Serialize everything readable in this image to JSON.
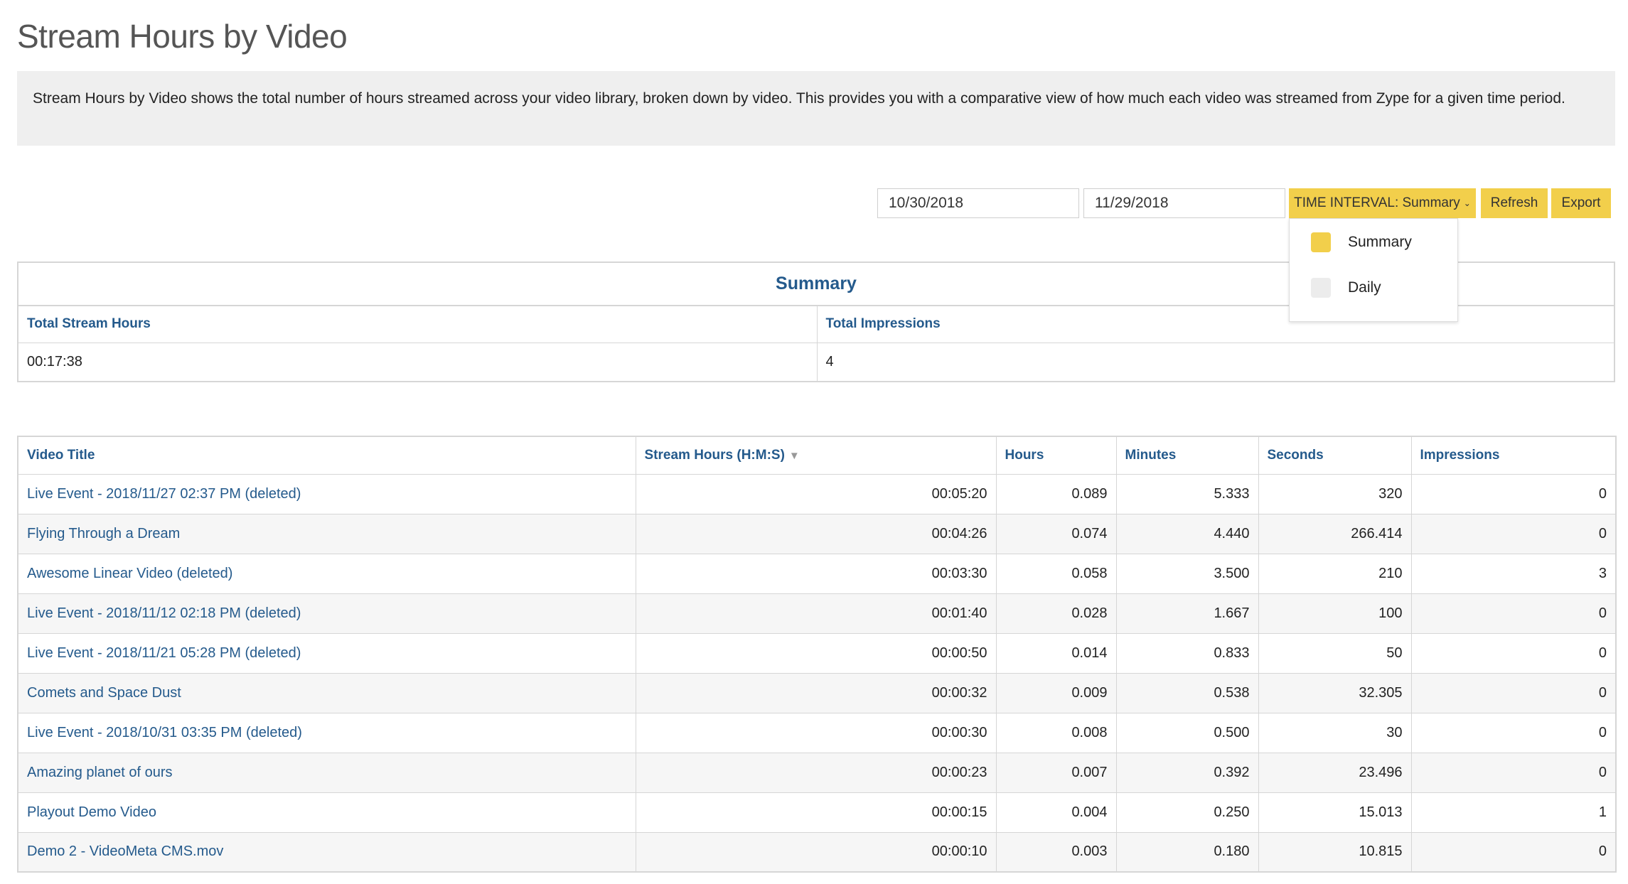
{
  "page": {
    "title": "Stream Hours by Video",
    "description": "Stream Hours by Video shows the total number of hours streamed across your video library, broken down by video. This provides you with a comparative view of how much each video was streamed from Zype for a given time period."
  },
  "controls": {
    "start_date": "10/30/2018",
    "end_date": "11/29/2018",
    "interval_label": "TIME INTERVAL: Summary",
    "refresh_label": "Refresh",
    "export_label": "Export"
  },
  "interval_menu": {
    "items": [
      {
        "label": "Summary",
        "swatch_color": "#f2cf4b"
      },
      {
        "label": "Daily",
        "swatch_color": "#ececec"
      }
    ]
  },
  "summary": {
    "heading": "Summary",
    "total_stream_hours_label": "Total Stream Hours",
    "total_impressions_label": "Total Impressions",
    "total_stream_hours": "00:17:38",
    "total_impressions": "4"
  },
  "videos": {
    "columns": [
      "Video Title",
      "Stream Hours (H:M:S)",
      "Hours",
      "Minutes",
      "Seconds",
      "Impressions"
    ],
    "rows": [
      {
        "title": "Live Event - 2018/11/27 02:37 PM (deleted)",
        "hms": "00:05:20",
        "hours": "0.089",
        "minutes": "5.333",
        "seconds": "320",
        "impressions": "0"
      },
      {
        "title": "Flying Through a Dream",
        "hms": "00:04:26",
        "hours": "0.074",
        "minutes": "4.440",
        "seconds": "266.414",
        "impressions": "0"
      },
      {
        "title": "Awesome Linear Video (deleted)",
        "hms": "00:03:30",
        "hours": "0.058",
        "minutes": "3.500",
        "seconds": "210",
        "impressions": "3"
      },
      {
        "title": "Live Event - 2018/11/12 02:18 PM (deleted)",
        "hms": "00:01:40",
        "hours": "0.028",
        "minutes": "1.667",
        "seconds": "100",
        "impressions": "0"
      },
      {
        "title": "Live Event - 2018/11/21 05:28 PM (deleted)",
        "hms": "00:00:50",
        "hours": "0.014",
        "minutes": "0.833",
        "seconds": "50",
        "impressions": "0"
      },
      {
        "title": "Comets and Space Dust",
        "hms": "00:00:32",
        "hours": "0.009",
        "minutes": "0.538",
        "seconds": "32.305",
        "impressions": "0"
      },
      {
        "title": "Live Event - 2018/10/31 03:35 PM (deleted)",
        "hms": "00:00:30",
        "hours": "0.008",
        "minutes": "0.500",
        "seconds": "30",
        "impressions": "0"
      },
      {
        "title": "Amazing planet of ours",
        "hms": "00:00:23",
        "hours": "0.007",
        "minutes": "0.392",
        "seconds": "23.496",
        "impressions": "0"
      },
      {
        "title": "Playout Demo Video",
        "hms": "00:00:15",
        "hours": "0.004",
        "minutes": "0.250",
        "seconds": "15.013",
        "impressions": "1"
      },
      {
        "title": "Demo 2 - VideoMeta CMS.mov",
        "hms": "00:00:10",
        "hours": "0.003",
        "minutes": "0.180",
        "seconds": "10.815",
        "impressions": "0"
      }
    ]
  }
}
